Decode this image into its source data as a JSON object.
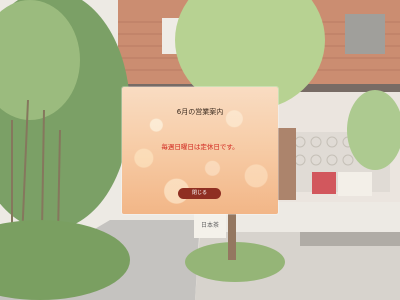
{
  "notice": {
    "title": "6月の営業案内",
    "message": "毎週日曜日は定休日です。",
    "close_label": "閉じる"
  },
  "background": {
    "shop_sign": "日本茶",
    "colors": {
      "wall": "#b86a4a",
      "foliage": "#6f9a52",
      "path": "#b9b6b2"
    }
  },
  "colors": {
    "message_red": "#d0241c",
    "button": "#8f2f22",
    "panel": "#f7cda8"
  }
}
